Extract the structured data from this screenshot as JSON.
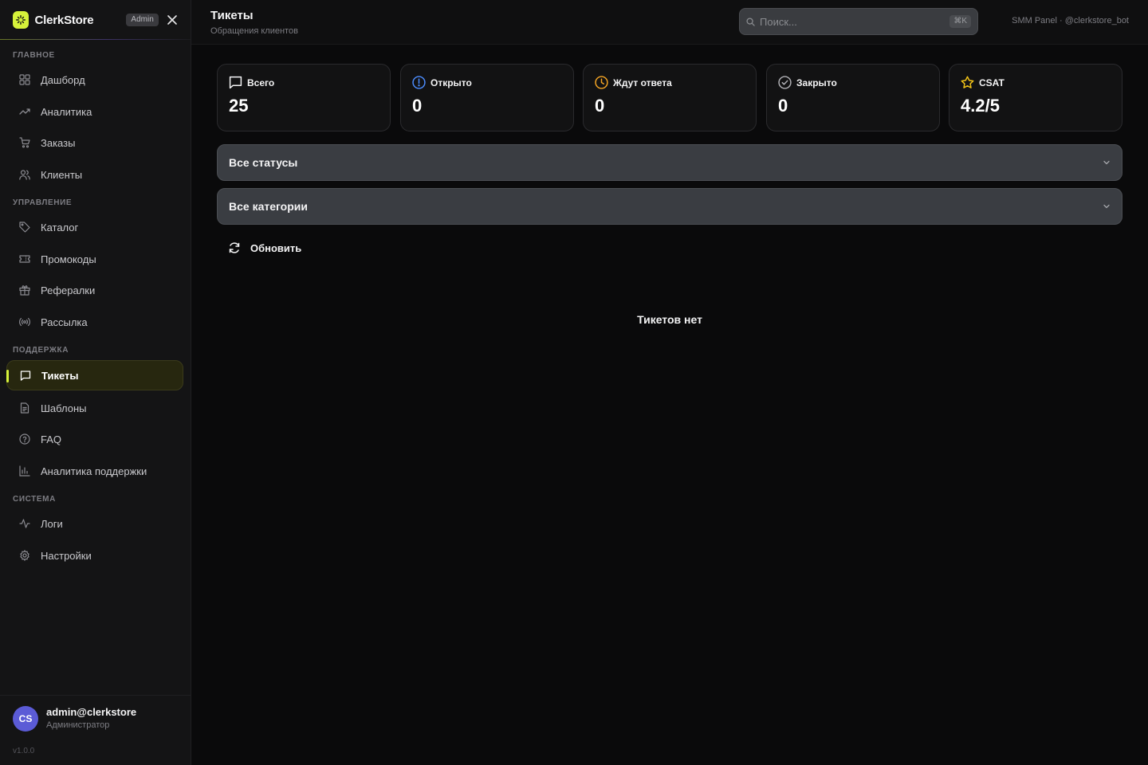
{
  "brand": {
    "name": "ClerkStore",
    "badge": "Admin"
  },
  "sidebar": {
    "sections": [
      {
        "title": "ГЛАВНОЕ",
        "items": [
          {
            "label": "Дашборд",
            "icon": "grid-icon"
          },
          {
            "label": "Аналитика",
            "icon": "trend-icon"
          },
          {
            "label": "Заказы",
            "icon": "cart-icon"
          },
          {
            "label": "Клиенты",
            "icon": "users-icon"
          }
        ]
      },
      {
        "title": "УПРАВЛЕНИЕ",
        "items": [
          {
            "label": "Каталог",
            "icon": "tag-icon"
          },
          {
            "label": "Промокоды",
            "icon": "ticket-icon"
          },
          {
            "label": "Рефералки",
            "icon": "gift-icon"
          },
          {
            "label": "Рассылка",
            "icon": "broadcast-icon"
          }
        ]
      },
      {
        "title": "ПОДДЕРЖКА",
        "items": [
          {
            "label": "Тикеты",
            "icon": "message-icon",
            "active": true
          },
          {
            "label": "Шаблоны",
            "icon": "file-icon"
          },
          {
            "label": "FAQ",
            "icon": "help-circle-icon"
          },
          {
            "label": "Аналитика поддержки",
            "icon": "bar-chart-icon"
          }
        ]
      },
      {
        "title": "СИСТЕМА",
        "items": [
          {
            "label": "Логи",
            "icon": "activity-icon"
          },
          {
            "label": "Настройки",
            "icon": "gear-icon"
          }
        ]
      }
    ]
  },
  "user": {
    "initials": "CS",
    "name": "admin@clerkstore",
    "role": "Администратор",
    "version": "v1.0.0"
  },
  "header": {
    "title": "Тикеты",
    "subtitle": "Обращения клиентов",
    "search_placeholder": "Поиск...",
    "search_shortcut": "⌘K",
    "context": "SMM Panel · @clerkstore_bot"
  },
  "stats": [
    {
      "label": "Всего",
      "value": "25",
      "icon": "message-icon",
      "color": "#f4f4f5"
    },
    {
      "label": "Открыто",
      "value": "0",
      "icon": "alert-circle-icon",
      "color": "#4c8dff"
    },
    {
      "label": "Ждут ответа",
      "value": "0",
      "icon": "clock-icon",
      "color": "#f5a524"
    },
    {
      "label": "Закрыто",
      "value": "0",
      "icon": "check-circle-icon",
      "color": "#b0b0b5"
    },
    {
      "label": "CSAT",
      "value": "4.2/5",
      "icon": "star-icon",
      "color": "#f5c518"
    }
  ],
  "filters": {
    "status": "Все статусы",
    "category": "Все категории"
  },
  "refresh_label": "Обновить",
  "empty_text": "Тикетов нет",
  "colors": {
    "accent": "#d6f23a",
    "background": "#0a0a0b",
    "sidebar": "#141415",
    "avatar": "#5b5bd6"
  }
}
